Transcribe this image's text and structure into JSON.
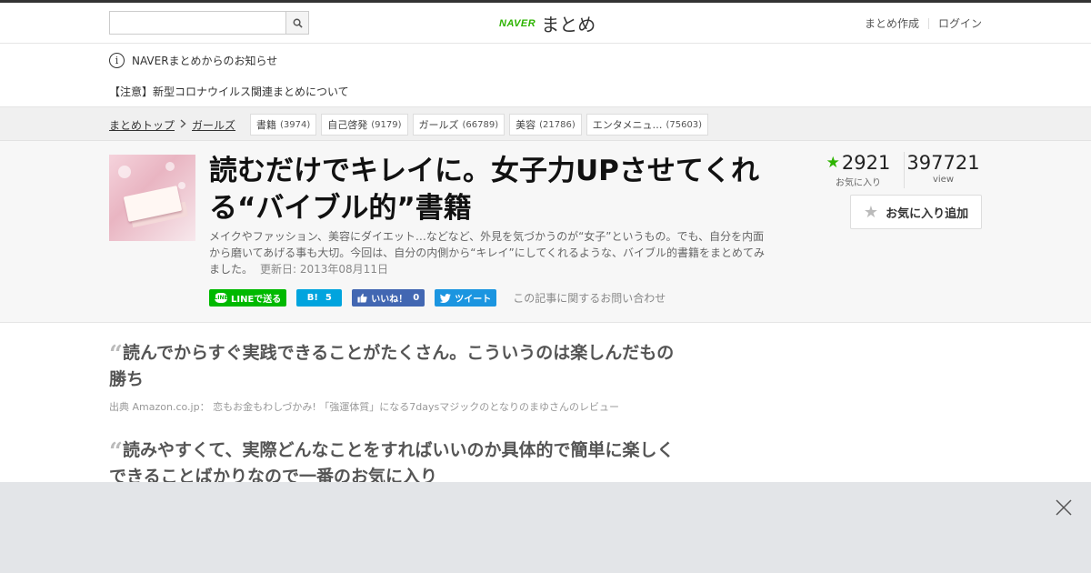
{
  "header": {
    "search_placeholder": "",
    "logo_naver": "NAVER",
    "logo_matome": "まとめ",
    "nav_create": "まとめ作成",
    "nav_login": "ログイン"
  },
  "notice": {
    "title": "NAVERまとめからのお知らせ",
    "item": "【注意】新型コロナウイルス関連まとめについて"
  },
  "breadcrumb": {
    "top": "まとめトップ",
    "category": "ガールズ"
  },
  "tags": [
    {
      "label": "書籍",
      "count": "(3974)"
    },
    {
      "label": "自己啓発",
      "count": "(9179)"
    },
    {
      "label": "ガールズ",
      "count": "(66789)"
    },
    {
      "label": "美容",
      "count": "(21786)"
    },
    {
      "label": "エンタメニュ…",
      "count": "(75603)"
    }
  ],
  "article": {
    "title": "読むだけでキレイに。女子力UPさせてくれる“バイブル的”書籍",
    "description": "メイクやファッション、美容にダイエット…などなど、外見を気づかうのが“女子”というもの。でも、自分を内面から磨いてあげる事も大切。今回は、自分の内側から“キレイ”にしてくれるような、バイブル的書籍をまとめてみました。",
    "updated": "更新日: 2013年08月11日"
  },
  "share": {
    "line_label": "LINEで送る",
    "line_icon": "LINE",
    "hatena_icon": "B!",
    "hatena_count": "5",
    "fb_label": "いいね！",
    "fb_count": "0",
    "tw_label": "ツイート",
    "inquiry": "この記事に関するお問い合わせ"
  },
  "stats": {
    "favorites": "2921",
    "favorites_label": "お気に入り",
    "views": "397721",
    "views_label": "view",
    "fav_button": "お気に入り追加"
  },
  "quotes": [
    {
      "text": "読んでからすぐ実践できることがたくさん。こういうのは楽しんだもの勝ち",
      "source": "出典  Amazon.co.jp： 恋もお金もわしづかみ! 「強運体質」になる7daysマジックのとなりのまゆさんのレビュー"
    },
    {
      "text": "読みやすくて、実際どんなことをすればいいのか具体的で簡単に楽しくできることばかりなので一番のお気に入り"
    }
  ],
  "colors": {
    "brand_green": "#2db400",
    "line_green": "#00b900",
    "hatena_blue": "#00a4de",
    "facebook_blue": "#4267b2",
    "twitter_blue": "#1b95e0"
  }
}
